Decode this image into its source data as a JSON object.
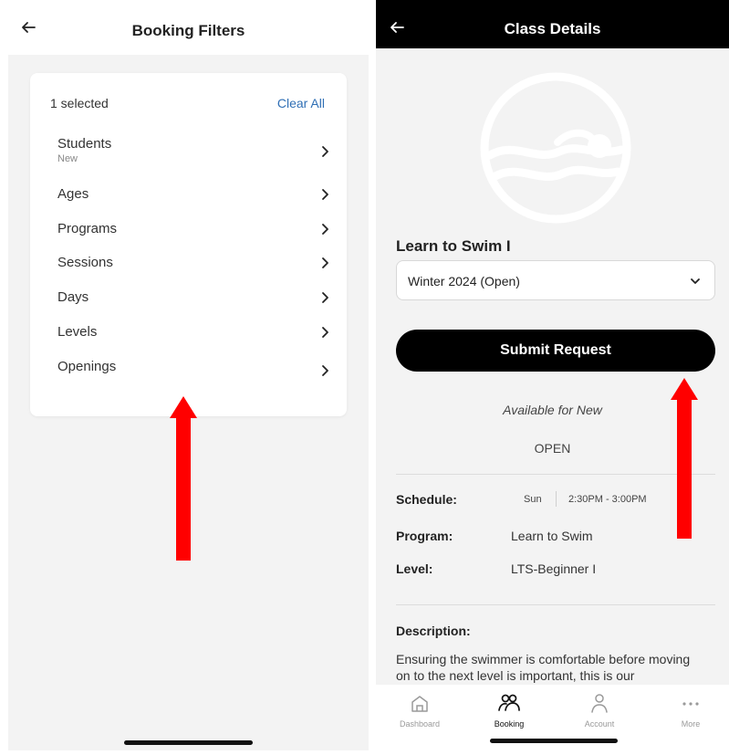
{
  "left": {
    "header_title": "Booking Filters",
    "selected_text": "1 selected",
    "clear_all": "Clear All",
    "filters": [
      {
        "label": "Students",
        "sub": "New"
      },
      {
        "label": "Ages",
        "sub": ""
      },
      {
        "label": "Programs",
        "sub": ""
      },
      {
        "label": "Sessions",
        "sub": ""
      },
      {
        "label": "Days",
        "sub": ""
      },
      {
        "label": "Levels",
        "sub": ""
      },
      {
        "label": "Openings",
        "sub": ""
      }
    ]
  },
  "right": {
    "header_title": "Class Details",
    "class_title": "Learn to Swim I",
    "session_value": "Winter 2024 (Open)",
    "submit_label": "Submit Request",
    "availability": "Available for New",
    "status": "OPEN",
    "schedule_label": "Schedule:",
    "schedule_day": "Sun",
    "schedule_time": "2:30PM - 3:00PM",
    "program_label": "Program:",
    "program_value": "Learn to Swim",
    "level_label": "Level:",
    "level_value": "LTS-Beginner I",
    "description_label": "Description:",
    "description_text": "Ensuring the swimmer is comfortable before moving on to the next level is important, this is our",
    "tabs": [
      {
        "label": "Dashboard",
        "icon": "home-icon"
      },
      {
        "label": "Booking",
        "icon": "people-icon"
      },
      {
        "label": "Account",
        "icon": "person-icon"
      },
      {
        "label": "More",
        "icon": "more-icon"
      }
    ]
  },
  "colors": {
    "arrow": "#ff0000",
    "link": "#2f6fb5",
    "header_dark": "#000000",
    "panel_bg": "#f3f3f3"
  }
}
